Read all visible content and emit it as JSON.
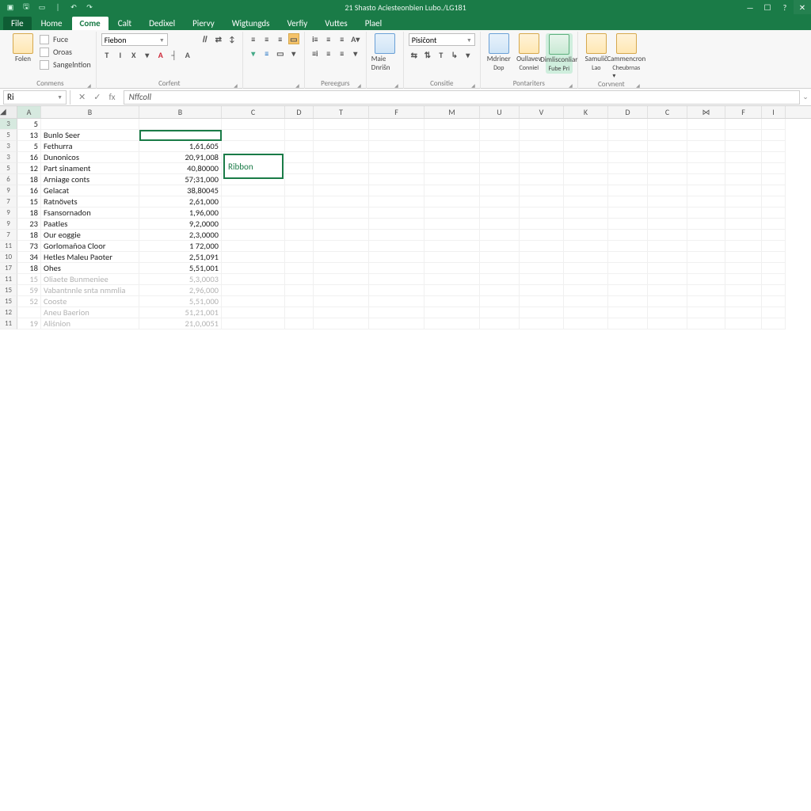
{
  "window": {
    "title": "21 Shasto Aciesteonbien Lubo./LG181",
    "qat": [
      "save",
      "doc",
      "square",
      "sep",
      "undo",
      "redo"
    ]
  },
  "tabs": {
    "file": "File",
    "items": [
      "Home",
      "Come",
      "Calt",
      "Dedixel",
      "Piervy",
      "Wigtungds",
      "Verfiy",
      "Vuttes",
      "Plael"
    ],
    "active_index": 1
  },
  "ribbon": {
    "clipboard": {
      "paste": "Folen",
      "items": [
        "Fuce",
        "Oroas",
        "Sangelntion"
      ],
      "label": "Conmens"
    },
    "font": {
      "fontbox": "Fiebon",
      "row1": [
        "𝐼𝐼",
        "⇄",
        "↕"
      ],
      "row2": [
        "T",
        "I",
        "X",
        "▾",
        "A",
        "┤",
        "A"
      ],
      "label": "Corfent"
    },
    "align": {
      "r1": [
        "≡",
        "≡",
        "≡",
        "▭"
      ],
      "r2": [
        "▾",
        "≡",
        "▭",
        "▾"
      ],
      "label": ""
    },
    "para": {
      "r1": [
        "i≡",
        "≡",
        "≡",
        "A▾"
      ],
      "r2": [
        "≡i",
        "≡",
        "≡",
        "▾"
      ],
      "label": "Pereegurs"
    },
    "merge": {
      "big": "Maie Dnrišn",
      "label": ""
    },
    "thingy": {
      "box": "Pisičont",
      "r": [
        "⇆",
        "⇅",
        "T",
        "↳",
        "▾"
      ],
      "label": "Consitie"
    },
    "btns": [
      {
        "l1": "Mdriner",
        "l2": "Dop",
        "cls": "blue"
      },
      {
        "l1": "Oullavev",
        "l2": "Conniel",
        "cls": ""
      },
      {
        "l1": "Dimlisconliar",
        "l2": "Fube Pri",
        "cls": "green active"
      },
      {
        "l1": "Samulič",
        "l2": "Lao",
        "cls": ""
      },
      {
        "l1": "Cammencron",
        "l2": "Cheubrnas ▾",
        "cls": ""
      }
    ],
    "pensLabel": "Pontariters",
    "commentLabel": "Corvnent"
  },
  "formulaBar": {
    "namebox": "Ri",
    "formula": "Nffcoll",
    "fx": [
      "✕",
      "✓",
      "fx"
    ]
  },
  "grid": {
    "cols": [
      "A",
      "B",
      "B",
      "C",
      "D",
      "T",
      "F",
      "M",
      "U",
      "V",
      "K",
      "D",
      "C",
      "⋈",
      "F",
      "I"
    ],
    "selectedCol": 0,
    "rows": [
      {
        "n": "3",
        "a": "5",
        "b": "",
        "c": ""
      },
      {
        "n": "5",
        "a": "13",
        "b": "Bunlo Seer",
        "c": ""
      },
      {
        "n": "3",
        "a": "5",
        "b": "Fethurra",
        "c": "1,61,605"
      },
      {
        "n": "3",
        "a": "16",
        "b": "Dunonicos",
        "c": "20,91,008"
      },
      {
        "n": "5",
        "a": "12",
        "b": "Part sinament",
        "c": "40,80000"
      },
      {
        "n": "6",
        "a": "18",
        "b": "Arniage conts",
        "c": "57;31,000"
      },
      {
        "n": "9",
        "a": "16",
        "b": "Gelacat",
        "c": "38,80045"
      },
      {
        "n": "7",
        "a": "15",
        "b": "Ratnövets",
        "c": "2,61,000"
      },
      {
        "n": "9",
        "a": "18",
        "b": "Fsansornadon",
        "c": "1,96,000"
      },
      {
        "n": "9",
        "a": "23",
        "b": "Paatles",
        "c": "9,2,0000"
      },
      {
        "n": "7",
        "a": "18",
        "b": "Our eoggie",
        "c": "2,3,0000"
      },
      {
        "n": "11",
        "a": "73",
        "b": "Gorlomañoa Cloor",
        "c": "1 72,000"
      },
      {
        "n": "10",
        "a": "34",
        "b": "Hetles Maleu Paoter",
        "c": "2,51,091"
      },
      {
        "n": "17",
        "a": "18",
        "b": "Ohes",
        "c": "5,51,001"
      },
      {
        "n": "11",
        "a": "15",
        "b": "Oliaete Bunmeniee",
        "c": "5,3,0003",
        "faded": true
      },
      {
        "n": "15",
        "a": "59",
        "b": "Vabantnnle snta nmmlia",
        "c": "2,96,000",
        "faded": true
      },
      {
        "n": "15",
        "a": "52",
        "b": "Cooste",
        "c": "5,51,000",
        "faded": true
      },
      {
        "n": "12",
        "a": "",
        "b": "Aneu Baerion",
        "c": "51,21,001",
        "faded": true
      },
      {
        "n": "11",
        "a": "19",
        "b": "Aliśnion",
        "c": "21,0,0051",
        "faded": true
      }
    ],
    "overlay": "Ribbon"
  }
}
